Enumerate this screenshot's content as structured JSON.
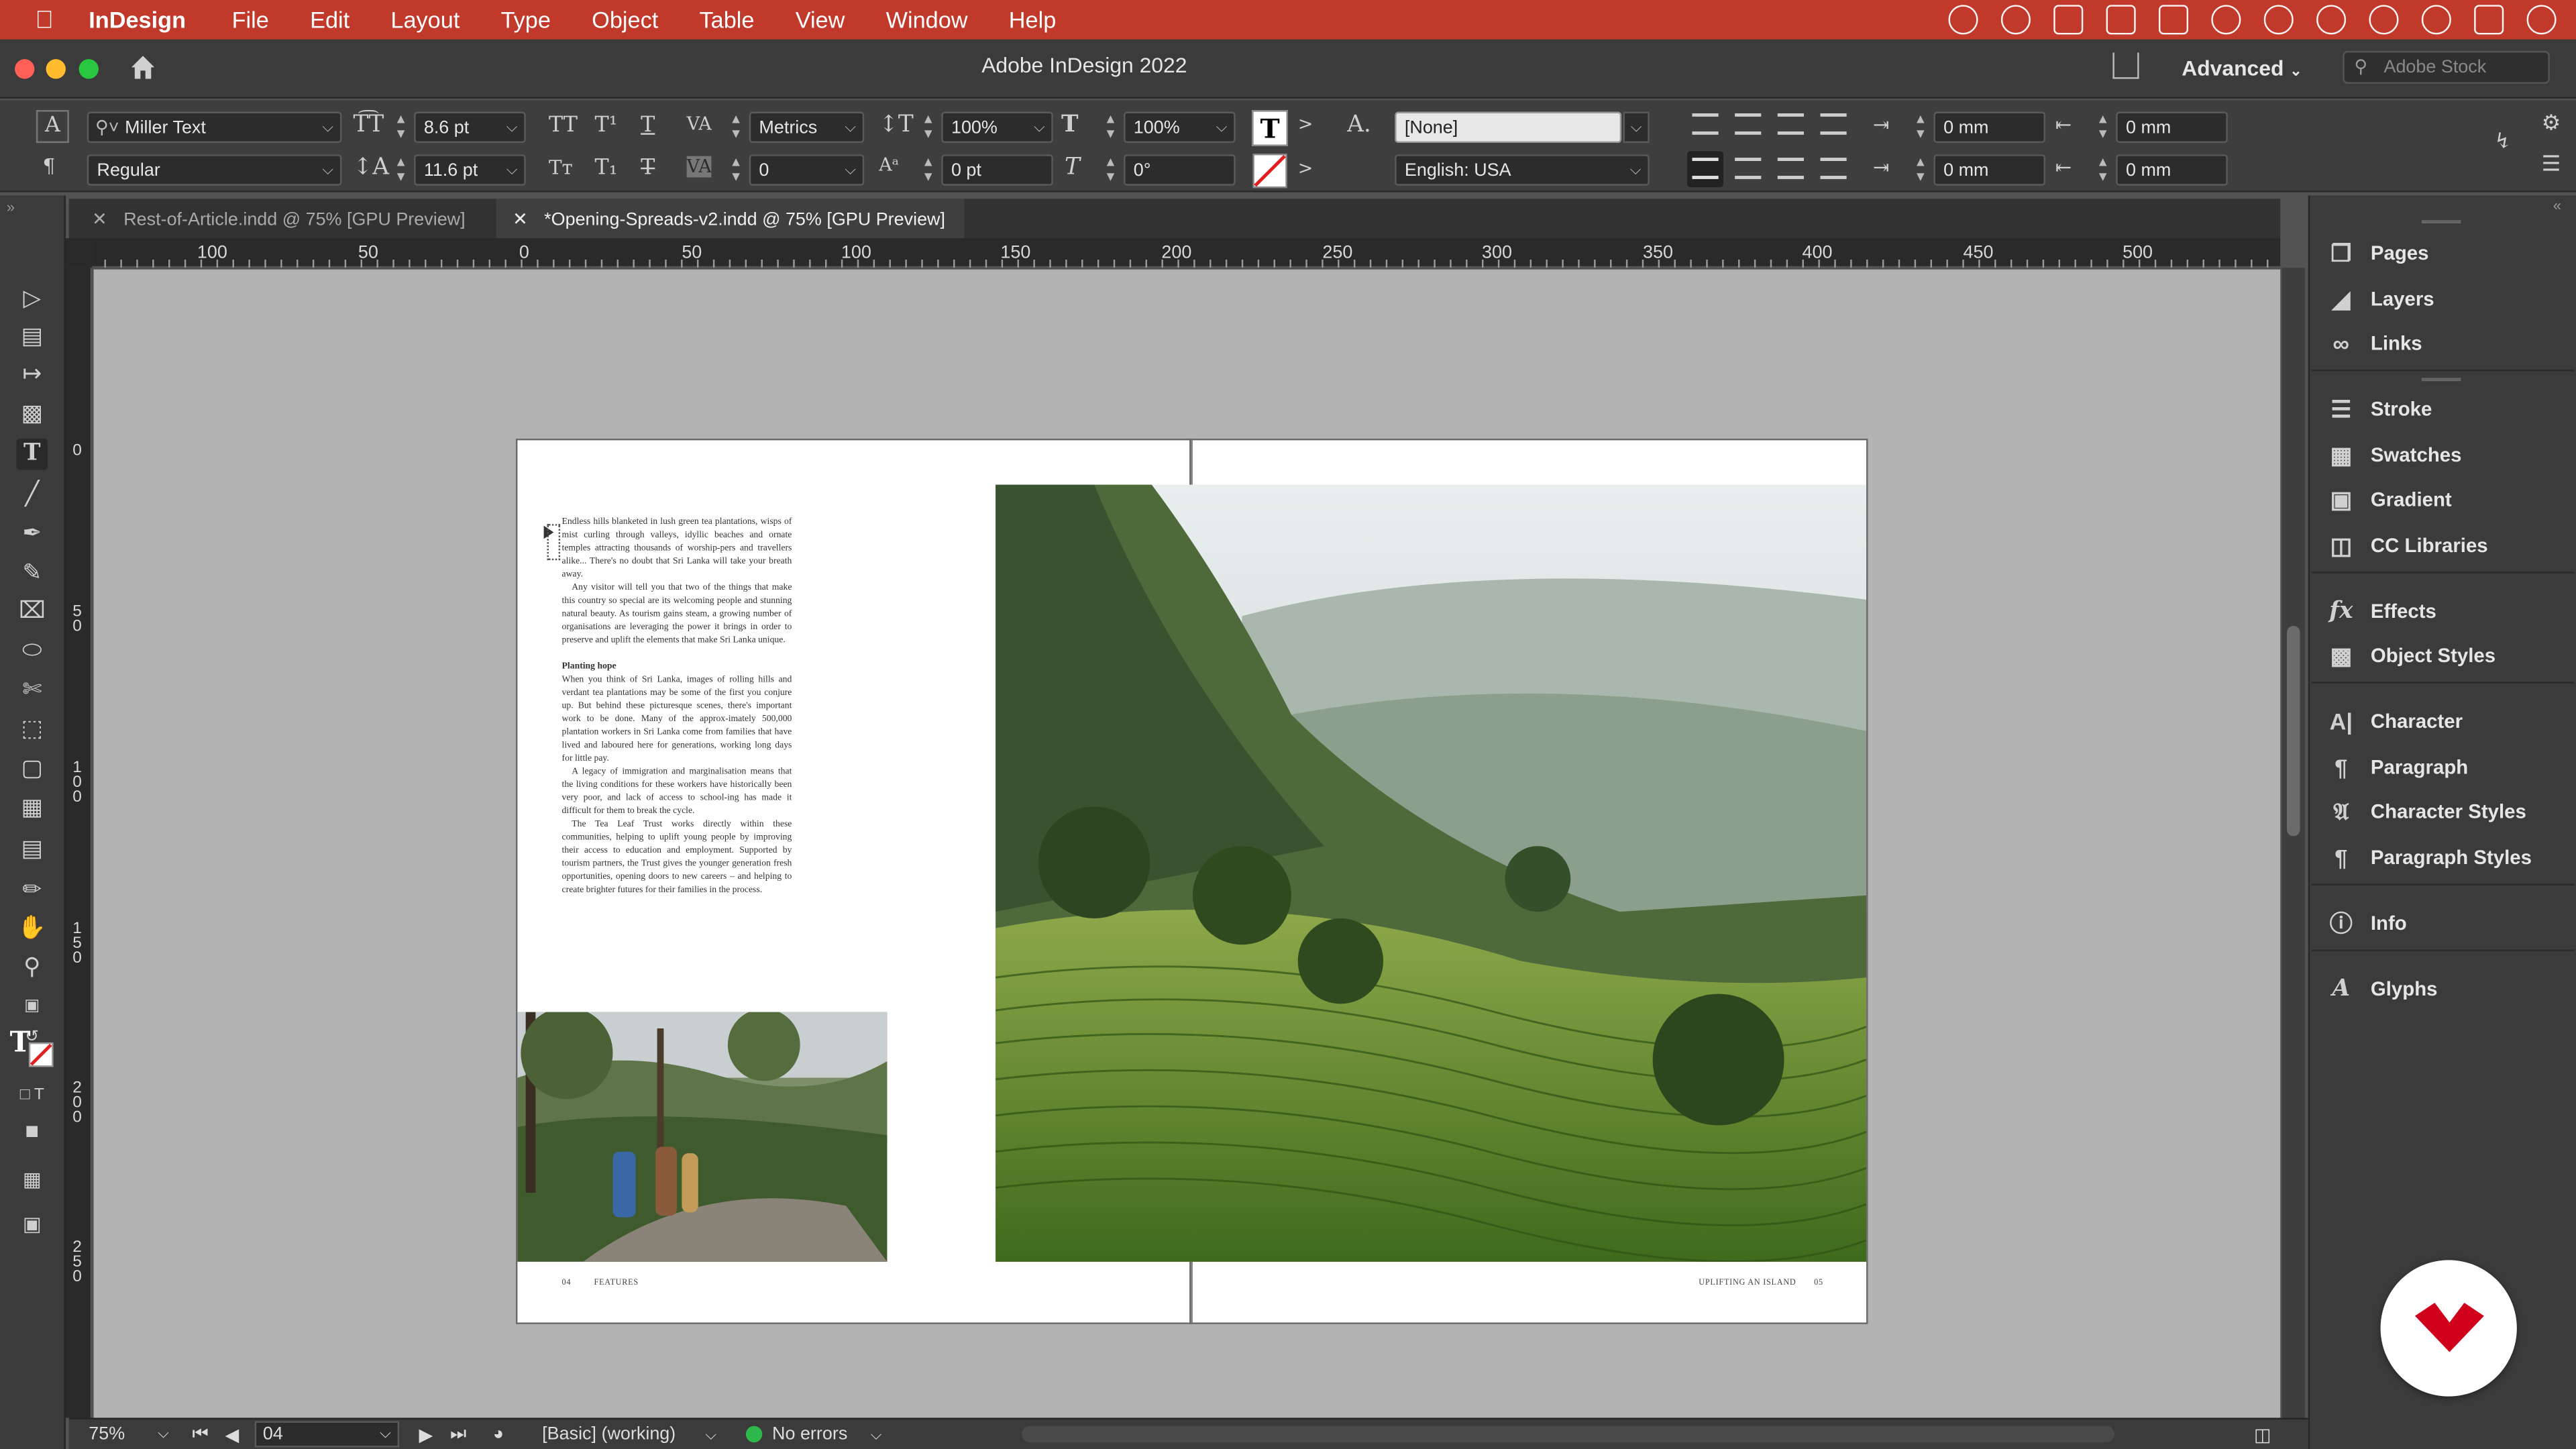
{
  "menubar": {
    "app": "InDesign",
    "items": [
      "File",
      "Edit",
      "Layout",
      "Type",
      "Object",
      "Table",
      "View",
      "Window",
      "Help"
    ]
  },
  "titlebar": {
    "title": "Adobe InDesign 2022",
    "workspace": "Advanced",
    "search_placeholder": "Adobe Stock"
  },
  "control": {
    "font_family": "Miller Text",
    "font_style": "Regular",
    "font_size": "8.6 pt",
    "leading": "11.6 pt",
    "kerning": "Metrics",
    "tracking": "0",
    "vertical_scale": "100%",
    "horizontal_scale": "100%",
    "baseline_shift": "0 pt",
    "skew": "0°",
    "char_style": "[None]",
    "language": "English: USA",
    "left_indent": "0 mm",
    "right_indent": "0 mm",
    "first_line_indent": "0 mm",
    "last_line_indent": "0 mm"
  },
  "tabs": [
    {
      "label": "Rest-of-Article.indd @ 75% [GPU Preview]",
      "active": false
    },
    {
      "label": "*Opening-Spreads-v2.indd @ 75% [GPU Preview]",
      "active": true
    }
  ],
  "ruler": {
    "h_labels": [
      "100",
      "50",
      "0",
      "50",
      "100",
      "150",
      "200",
      "250",
      "300",
      "350",
      "400",
      "450",
      "500"
    ],
    "v_labels": [
      "0",
      "50",
      "100",
      "150",
      "200",
      "250"
    ]
  },
  "document": {
    "paragraphs": [
      "Endless hills blanketed in lush green tea plantations, wisps of mist curling through valleys, idyllic beaches and ornate temples attracting thousands of worship-pers and travellers alike... There's no doubt that Sri Lanka will take your breath away.",
      "Any visitor will tell you that two of the things that make this country so special are its welcoming people and stunning natural beauty. As tourism gains steam, a growing number of organisations are leveraging the power it brings in order to preserve and uplift the elements that make Sri Lanka unique."
    ],
    "subhead": "Planting hope",
    "paragraphs2": [
      "When you think of Sri Lanka, images of rolling hills and verdant tea plantations may be some of the first you conjure up. But behind these picturesque scenes, there's important work to be done. Many of the approx-imately 500,000 plantation workers in Sri Lanka come from families that have lived and laboured here for generations, working long days for little pay.",
      "A legacy of immigration and marginalisation means that the living conditions for these workers have historically been very poor, and lack of access to school-ing has made it difficult for them to break the cycle.",
      "The Tea Leaf Trust works directly within these communities, helping to uplift young people by improving their access to education and employment. Supported by tourism partners, the Trust gives the younger generation fresh opportunities, opening doors to new careers – and helping to create brighter futures for their families in the process."
    ],
    "folio_left_num": "04",
    "folio_left_section": "FEATURES",
    "folio_right_title": "UPLIFTING AN ISLAND",
    "folio_right_num": "05"
  },
  "panels": {
    "items": [
      "Pages",
      "Layers",
      "Links",
      "Stroke",
      "Swatches",
      "Gradient",
      "CC Libraries",
      "Effects",
      "Object Styles",
      "Character",
      "Paragraph",
      "Character Styles",
      "Paragraph Styles",
      "Info",
      "Glyphs"
    ]
  },
  "status": {
    "zoom": "75%",
    "page": "04",
    "preflight_profile": "[Basic] (working)",
    "errors": "No errors"
  },
  "colors": {
    "menubar": "#c0392b",
    "accent_badge": "#d0021b",
    "no_errors": "#2eb84c"
  }
}
